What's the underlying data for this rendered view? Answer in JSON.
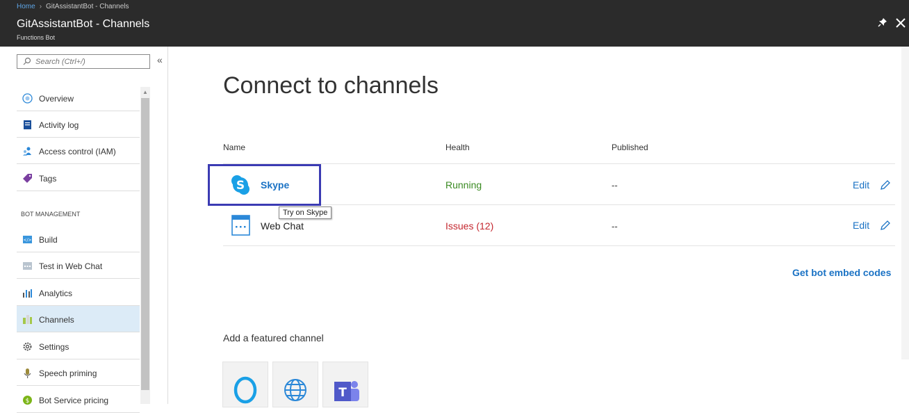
{
  "breadcrumb": {
    "home": "Home",
    "separator": "›",
    "current": "GitAssistantBot - Channels"
  },
  "header": {
    "title": "GitAssistantBot - Channels",
    "subtitle": "Functions Bot",
    "pin_icon": "pin-icon",
    "close_icon": "close-icon"
  },
  "sidebar": {
    "search_placeholder": "Search (Ctrl+/)",
    "collapse_label": "«",
    "items": [
      {
        "label": "Overview",
        "icon": "overview-icon"
      },
      {
        "label": "Activity log",
        "icon": "activity-log-icon"
      },
      {
        "label": "Access control (IAM)",
        "icon": "access-control-icon"
      },
      {
        "label": "Tags",
        "icon": "tag-icon"
      }
    ],
    "section_title": "BOT MANAGEMENT",
    "section_items": [
      {
        "label": "Build",
        "icon": "build-icon"
      },
      {
        "label": "Test in Web Chat",
        "icon": "test-web-chat-icon"
      },
      {
        "label": "Analytics",
        "icon": "analytics-icon"
      },
      {
        "label": "Channels",
        "icon": "channels-icon",
        "active": true
      },
      {
        "label": "Settings",
        "icon": "gear-icon"
      },
      {
        "label": "Speech priming",
        "icon": "microphone-icon"
      },
      {
        "label": "Bot Service pricing",
        "icon": "pricing-icon"
      }
    ]
  },
  "main": {
    "heading": "Connect to channels",
    "columns": {
      "name": "Name",
      "health": "Health",
      "published": "Published"
    },
    "channels": [
      {
        "name": "Skype",
        "health": "Running",
        "published": "--",
        "edit": "Edit",
        "icon": "skype-icon"
      },
      {
        "name": "Web Chat",
        "health": "Issues (12)",
        "published": "--",
        "edit": "Edit",
        "icon": "web-chat-icon"
      }
    ],
    "tooltip": "Try on Skype",
    "embed_link": "Get bot embed codes",
    "featured_title": "Add a featured channel",
    "featured": [
      "cortana-icon",
      "web-globe-icon",
      "teams-icon"
    ]
  },
  "colors": {
    "accent": "#1a72c4",
    "running": "#3a8a22",
    "issues": "#c4262e",
    "highlight": "#3b3bb3",
    "topbar": "#2b2b2b"
  }
}
